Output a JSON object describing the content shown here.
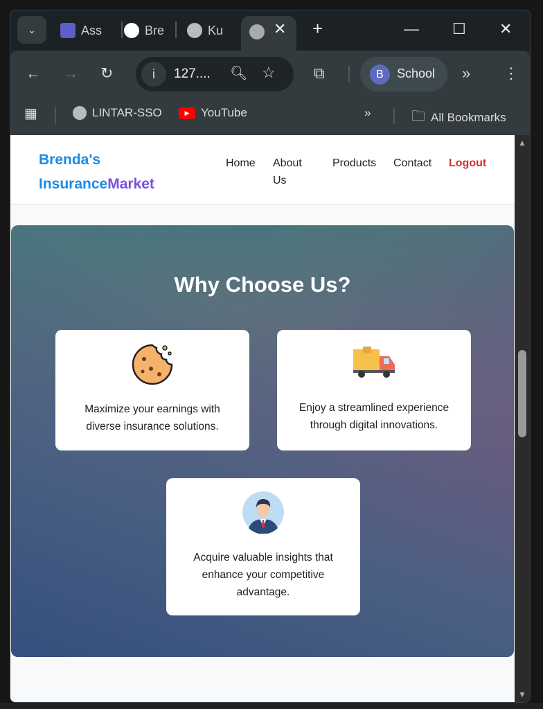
{
  "browser": {
    "tabs": [
      {
        "label": "Ass",
        "icon": "teams-icon"
      },
      {
        "label": "Bre",
        "icon": "github-icon"
      },
      {
        "label": "Ku",
        "icon": "globe-icon"
      },
      {
        "label": "",
        "icon": "globe-icon",
        "active": true
      }
    ],
    "url": "127....",
    "profile": {
      "initial": "B",
      "name": "School"
    },
    "bookmarks": [
      {
        "label": "LINTAR-SSO",
        "icon": "globe-icon"
      },
      {
        "label": "YouTube",
        "icon": "youtube-icon"
      }
    ],
    "all_bookmarks": "All Bookmarks"
  },
  "site": {
    "logo_part1": "Brenda's",
    "logo_part2": "Insurance",
    "logo_part3": "Market",
    "nav": {
      "home": "Home",
      "about": "About Us",
      "products": "Products",
      "contact": "Contact",
      "logout": "Logout"
    },
    "colors": {
      "logo_blue": "#1a8be6",
      "logo_purple": "#7b4fe0",
      "logout": "#d32f2f"
    }
  },
  "hero": {
    "title": "Why Choose Us?",
    "cards": [
      {
        "icon": "cookie-icon",
        "text": "Maximize your earnings with diverse insurance solutions."
      },
      {
        "icon": "delivery-truck-icon",
        "text": "Enjoy a streamlined experience through digital innovations."
      },
      {
        "icon": "businessman-icon",
        "text": "Acquire valuable insights that enhance your competitive advantage."
      }
    ]
  }
}
